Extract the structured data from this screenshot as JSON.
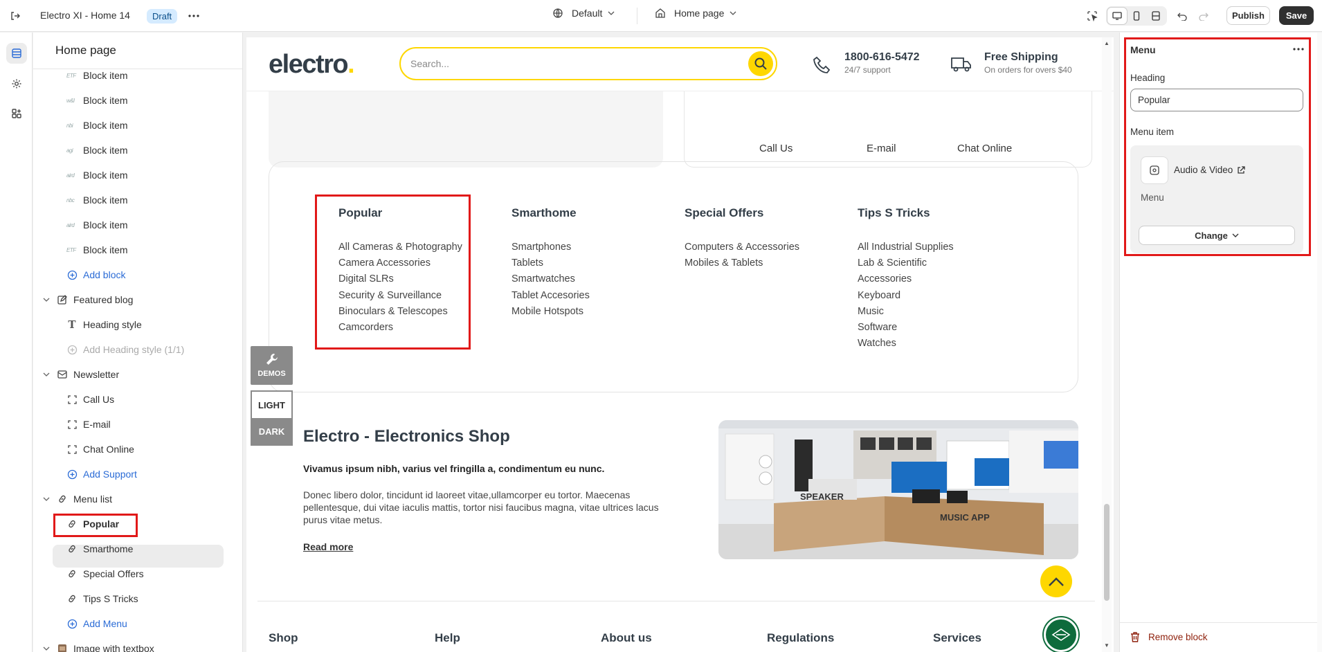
{
  "topbar": {
    "theme_name": "Electro XI - Home 14",
    "status_badge": "Draft",
    "view_default": "Default",
    "page_select": "Home page",
    "publish_label": "Publish",
    "save_label": "Save"
  },
  "left_panel": {
    "title": "Home page",
    "block_items": [
      {
        "thumb": "ETF",
        "label": "Block item"
      },
      {
        "thumb": "w&l",
        "label": "Block item"
      },
      {
        "thumb": "nbi",
        "label": "Block item"
      },
      {
        "thumb": "agi",
        "label": "Block item"
      },
      {
        "thumb": "aird",
        "label": "Block item"
      },
      {
        "thumb": "nbc",
        "label": "Block item"
      },
      {
        "thumb": "aird",
        "label": "Block item"
      },
      {
        "thumb": "ETF",
        "label": "Block item"
      }
    ],
    "add_block": "Add block",
    "featured_blog": "Featured blog",
    "heading_style": "Heading style",
    "add_heading_style": "Add Heading style (1/1)",
    "newsletter": "Newsletter",
    "call_us": "Call Us",
    "email": "E-mail",
    "chat_online": "Chat Online",
    "add_support": "Add Support",
    "menu_list": "Menu list",
    "menus": [
      "Popular",
      "Smarthome",
      "Special Offers",
      "Tips S Tricks"
    ],
    "add_menu": "Add Menu",
    "image_with_textbox": "Image with textbox"
  },
  "store": {
    "logo_text": "electro",
    "logo_dot": ".",
    "search_placeholder": "Search...",
    "phone": "1800-616-5472",
    "phone_sub": "24/7 support",
    "shipping": "Free Shipping",
    "shipping_sub": "On orders for overs $40",
    "newsletter_links": [
      "Call Us",
      "E-mail",
      "Chat Online"
    ],
    "menu_columns": [
      {
        "heading": "Popular",
        "items": [
          "All Cameras & Photography",
          "Camera Accessories",
          "Digital SLRs",
          "Security & Surveillance",
          "Binoculars & Telescopes",
          "Camcorders"
        ]
      },
      {
        "heading": "Smarthome",
        "items": [
          "Smartphones",
          "Tablets",
          "Smartwatches",
          "Tablet Accesories",
          "Mobile Hotspots"
        ]
      },
      {
        "heading": "Special Offers",
        "items": [
          "Computers & Accessories",
          "Mobiles & Tablets"
        ]
      },
      {
        "heading": "Tips S Tricks",
        "items": [
          "All Industrial Supplies",
          "Lab & Scientific",
          "Accessories",
          "Keyboard",
          "Music",
          "Software",
          "Watches"
        ]
      }
    ],
    "demos": "DEMOS",
    "light": "LIGHT",
    "dark": "DARK",
    "shop_heading": "Electro - Electronics Shop",
    "shop_sub": "Vivamus ipsum nibh, varius vel fringilla a, condimentum eu nunc.",
    "shop_body": "Donec libero dolor, tincidunt id laoreet vitae,ullamcorper eu tortor. Maecenas pellentesque, dui vitae iaculis mattis, tortor nisi faucibus magna, vitae ultrices lacus purus vitae metus.",
    "read_more": "Read more",
    "image_signs": [
      "SPEAKER",
      "MUSIC APP"
    ],
    "footer_cols": [
      "Shop",
      "Help",
      "About us",
      "Regulations",
      "Services"
    ]
  },
  "right_panel": {
    "title": "Menu",
    "heading_label": "Heading",
    "heading_value": "Popular",
    "menu_item_label": "Menu item",
    "menu_item_name": "Audio & Video",
    "menu_item_type": "Menu",
    "change_label": "Change",
    "remove_label": "Remove block"
  },
  "colors": {
    "accent": "#fed700",
    "highlight": "#e11919",
    "link": "#2a6bd6"
  }
}
